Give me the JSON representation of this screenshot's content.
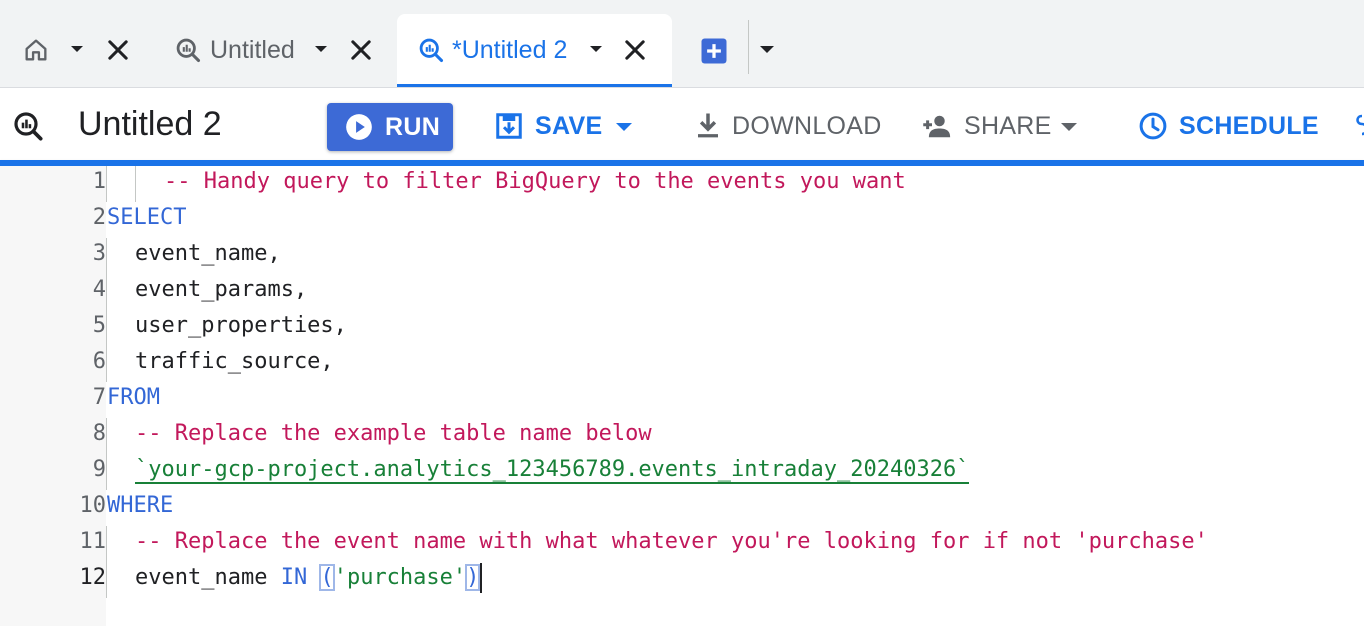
{
  "tabs": {
    "home_tab_label": "",
    "tab_1": {
      "label": "Untitled"
    },
    "tab_2": {
      "label": "*Untitled 2",
      "active": true
    }
  },
  "toolbar": {
    "query_title": "Untitled 2",
    "run_label": "RUN",
    "save_label": "SAVE",
    "download_label": "DOWNLOAD",
    "share_label": "SHARE",
    "schedule_label": "SCHEDULE"
  },
  "editor": {
    "line_numbers": [
      "1",
      "2",
      "3",
      "4",
      "5",
      "6",
      "7",
      "8",
      "9",
      "10",
      "11",
      "12"
    ],
    "current_line": "12",
    "lines": [
      {
        "parts": [
          {
            "t": "-- Handy query to filter BigQuery to the events you want",
            "c": "cm"
          }
        ]
      },
      {
        "parts": [
          {
            "t": "SELECT",
            "c": "kw"
          }
        ]
      },
      {
        "parts": [
          {
            "t": "event_name,",
            "c": ""
          }
        ]
      },
      {
        "parts": [
          {
            "t": "event_params,",
            "c": ""
          }
        ]
      },
      {
        "parts": [
          {
            "t": "user_properties,",
            "c": ""
          }
        ]
      },
      {
        "parts": [
          {
            "t": "traffic_source,",
            "c": ""
          }
        ]
      },
      {
        "parts": [
          {
            "t": "FROM",
            "c": "kw"
          }
        ]
      },
      {
        "parts": [
          {
            "t": "-- Replace the example table name below",
            "c": "cm"
          }
        ]
      },
      {
        "parts": [
          {
            "t": "`your-gcp-project.analytics_123456789.events_intraday_20240326`",
            "c": "tbl"
          }
        ]
      },
      {
        "parts": [
          {
            "t": "WHERE",
            "c": "kw"
          }
        ]
      },
      {
        "parts": [
          {
            "t": "-- Replace the event name with what whatever you're looking for if not 'purchase'",
            "c": "cm"
          }
        ]
      },
      {
        "parts": [
          {
            "t": "event_name ",
            "c": ""
          },
          {
            "t": "IN",
            "c": "kw"
          },
          {
            "t": " ",
            "c": ""
          },
          {
            "t": "(",
            "c": "paren"
          },
          {
            "t": "'purchase'",
            "c": "str"
          },
          {
            "t": ")",
            "c": "paren"
          }
        ]
      }
    ]
  },
  "colors": {
    "accent": "#1a73e8",
    "run_button": "#3d6ad6",
    "keyword": "#3367d6",
    "comment": "#c5221f",
    "string": "#188038"
  },
  "icons": {
    "home": "home-icon",
    "query": "query-icon",
    "close": "close-icon",
    "add": "add-tab-icon",
    "play": "play-icon",
    "save": "save-icon",
    "download": "download-icon",
    "share": "person-add-icon",
    "schedule": "clock-icon"
  }
}
